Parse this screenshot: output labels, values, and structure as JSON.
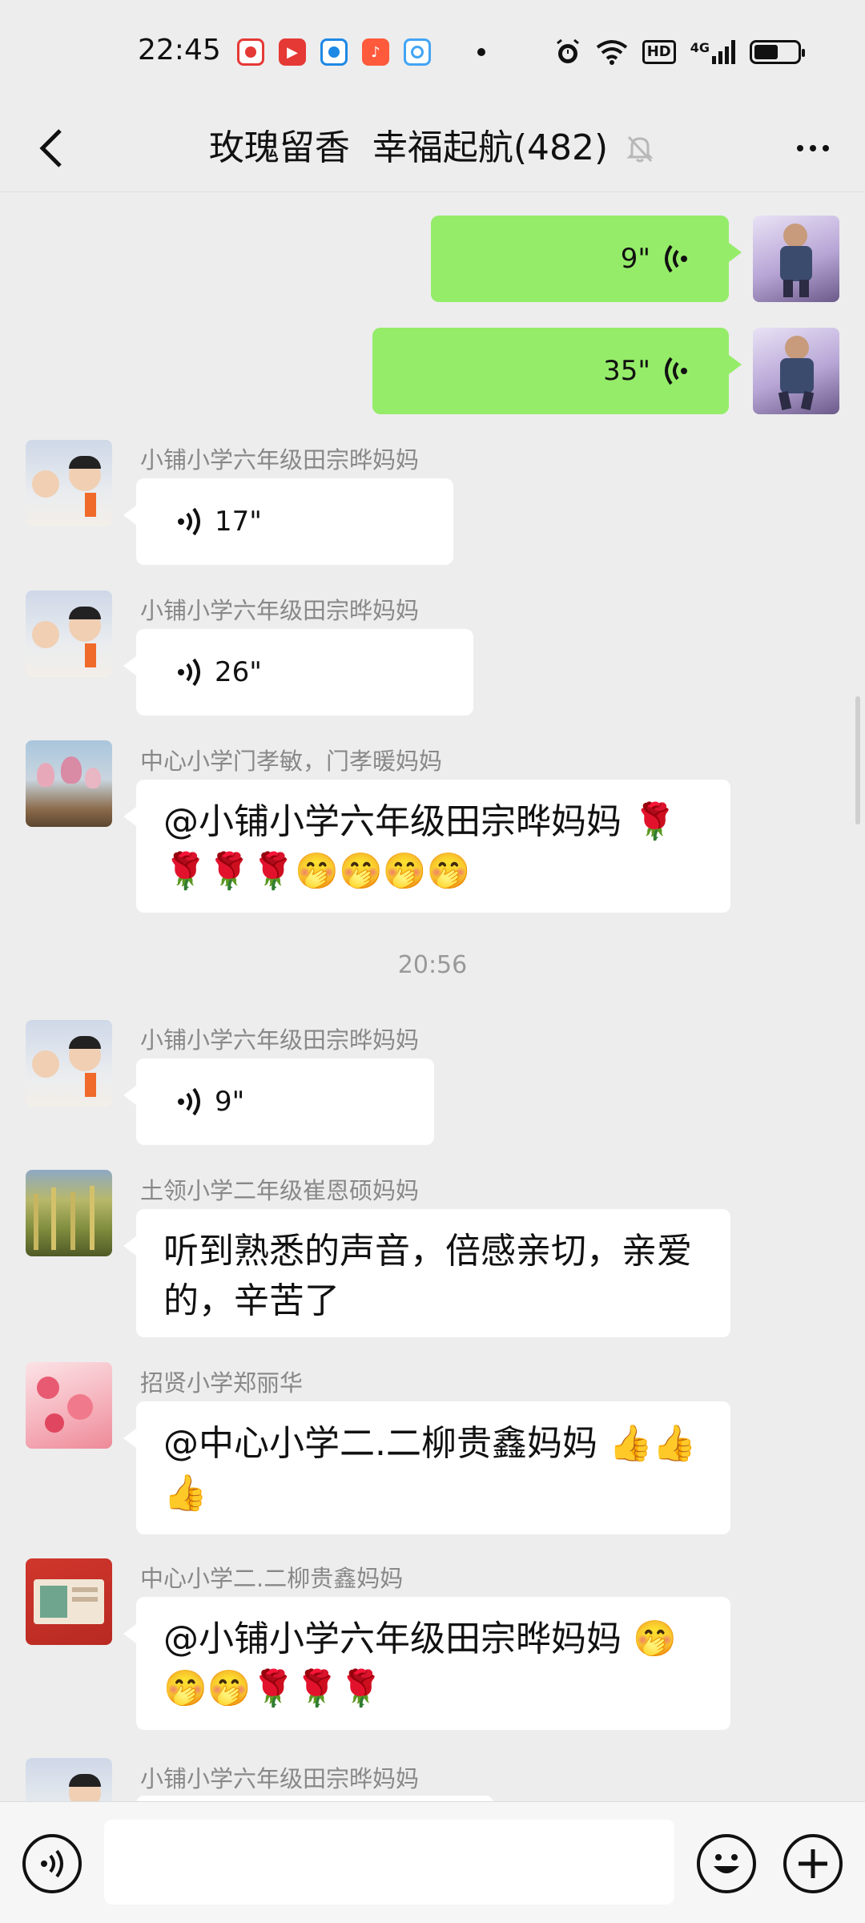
{
  "status": {
    "time": "22:45",
    "network": "HD",
    "signal_label": "4G",
    "battery_level": 0.55
  },
  "nav": {
    "title": "玫瑰留香  幸福起航(482)"
  },
  "messages": [
    {
      "side": "right",
      "type": "voice",
      "duration": "9\""
    },
    {
      "side": "right",
      "type": "voice",
      "duration": "35\""
    },
    {
      "side": "left",
      "type": "voice",
      "sender": "小铺小学六年级田宗晔妈妈",
      "duration": "17\""
    },
    {
      "side": "left",
      "type": "voice",
      "sender": "小铺小学六年级田宗晔妈妈",
      "duration": "26\""
    },
    {
      "side": "left",
      "type": "text",
      "sender": "中心小学门孝敏，门孝暖妈妈",
      "text": "@小铺小学六年级田宗晔妈妈 🌹🌹🌹🌹🤭🤭🤭🤭"
    },
    {
      "type": "time",
      "text": "20:56"
    },
    {
      "side": "left",
      "type": "voice",
      "sender": "小铺小学六年级田宗晔妈妈",
      "duration": "9\""
    },
    {
      "side": "left",
      "type": "text",
      "sender": "土领小学二年级崔恩硕妈妈",
      "text": "听到熟悉的声音，倍感亲切，亲爱的，辛苦了"
    },
    {
      "side": "left",
      "type": "text",
      "sender": "招贤小学郑丽华",
      "text": "@中心小学二.二柳贵鑫妈妈 👍👍👍"
    },
    {
      "side": "left",
      "type": "text",
      "sender": "中心小学二.二柳贵鑫妈妈",
      "text": "@小铺小学六年级田宗晔妈妈 🤭🤭🤭🌹🌹🌹"
    },
    {
      "side": "left",
      "type": "partial",
      "sender": "小铺小学六年级田宗晔妈妈"
    }
  ],
  "input": {
    "placeholder": ""
  },
  "icons": {
    "back": "chevron-left-icon",
    "mute": "bell-off-icon",
    "more": "more-dots-icon",
    "voice": "voice-icon",
    "emoji": "emoji-icon",
    "plus": "plus-icon"
  },
  "colors": {
    "my_bubble": "#95ec69",
    "their_bubble": "#ffffff",
    "background": "#ededed"
  }
}
